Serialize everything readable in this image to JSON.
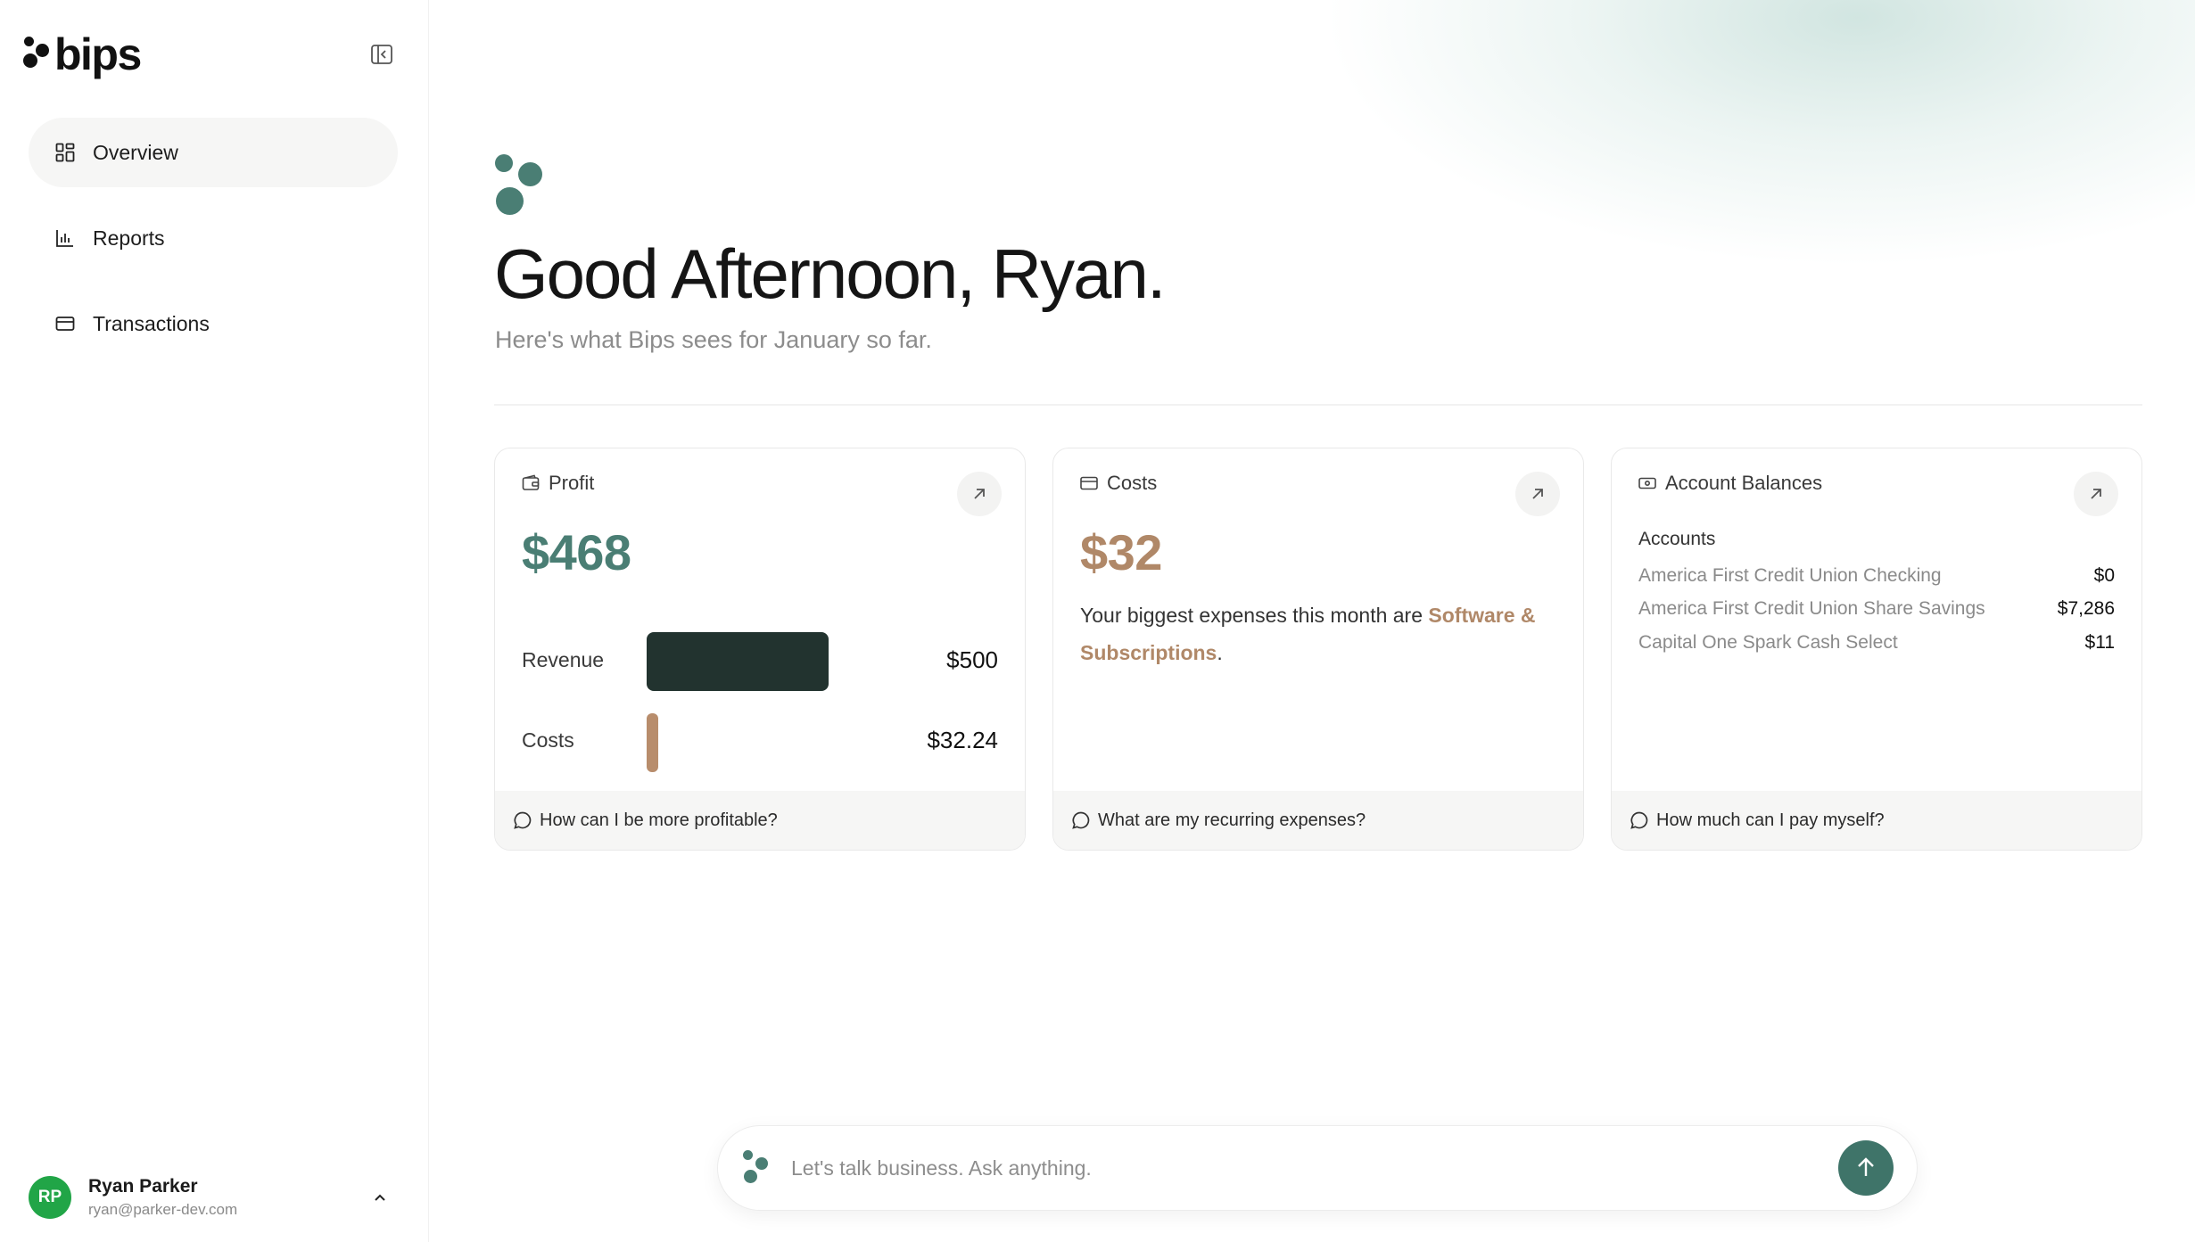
{
  "app": {
    "name": "bips"
  },
  "sidebar": {
    "items": [
      {
        "label": "Overview",
        "icon": "grid-icon",
        "active": true
      },
      {
        "label": "Reports",
        "icon": "bar-chart-icon",
        "active": false
      },
      {
        "label": "Transactions",
        "icon": "card-icon",
        "active": false
      }
    ],
    "user": {
      "initials": "RP",
      "name": "Ryan Parker",
      "email": "ryan@parker-dev.com"
    }
  },
  "header": {
    "greeting": "Good Afternoon, Ryan.",
    "subtitle": "Here's what Bips sees for January so far."
  },
  "cards": {
    "profit": {
      "title": "Profit",
      "amount": "$468",
      "revenue_label": "Revenue",
      "revenue_value": "$500",
      "revenue_amount": 500,
      "costs_label": "Costs",
      "costs_value": "$32.24",
      "costs_amount": 32.24,
      "prompt": "How can I be more profitable?"
    },
    "costs": {
      "title": "Costs",
      "amount": "$32",
      "text_prefix": "Your biggest expenses this month are ",
      "highlight": "Software & Subscriptions",
      "text_suffix": ".",
      "prompt": "What are my recurring expenses?"
    },
    "balances": {
      "title": "Account Balances",
      "accounts_heading": "Accounts",
      "accounts": [
        {
          "name": "America First Credit Union Checking",
          "value": "$0"
        },
        {
          "name": "America First Credit Union Share Savings",
          "value": "$7,286"
        },
        {
          "name": "Capital One Spark Cash Select",
          "value": "$11"
        }
      ],
      "prompt": "How much can I pay myself?"
    }
  },
  "chat": {
    "placeholder": "Let's talk business. Ask anything."
  },
  "colors": {
    "accent": "#4a7e74",
    "revenue_bar": "#22332f",
    "costs_bar": "#b88d6c",
    "cost_highlight": "#b08868",
    "avatar": "#21a547"
  }
}
